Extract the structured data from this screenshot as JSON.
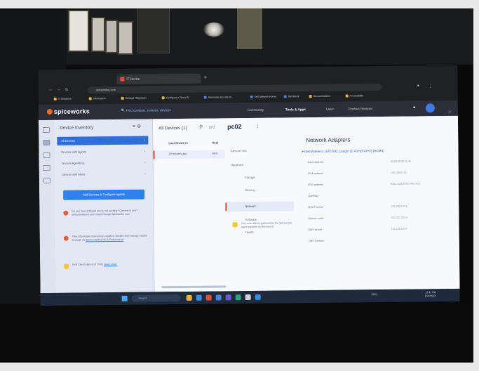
{
  "browser": {
    "tab_title": "IT Device",
    "address": "spiceworks.com",
    "bookmarks": [
      "IT Solutions",
      "Information",
      "Storage Objectives",
      "Configure a Site's Bt",
      "Associate any site to...",
      "Dell Network Home",
      "Dell Bond",
      "Documentation",
      "Accessibility"
    ]
  },
  "header": {
    "logo": "spiceworks",
    "search": "Find contents, reviews, devices",
    "nav": [
      "Community",
      "Tools & Apps",
      "Learn",
      "Product Reviews"
    ]
  },
  "sidebar": {
    "title": "Device Inventory",
    "items": [
      {
        "label": "All Devices"
      },
      {
        "label": "Devices with Agents"
      },
      {
        "label": "Devices Agentless"
      },
      {
        "label": "Devices with Alerts"
      }
    ],
    "cta": "Add Devices & Configure agents",
    "tips": [
      {
        "text": "Do you have software you're not tracking? Convert to an IT software/device and install through Spiceworks now."
      },
      {
        "text": "Take advantage of inventory analytics: Monitor and manage installs & usage on",
        "link": "Spice Dashboards & Performance"
      },
      {
        "text": "Find Cloud Apps to IT Tools",
        "link": "Learn more"
      }
    ]
  },
  "main": {
    "breadcrumb": "All Devices (1)",
    "search_value": "pc0",
    "device": "pc02",
    "columns": [
      "Last Check-in",
      "Heal"
    ],
    "rows": [
      {
        "checkin": "16 minutes ago",
        "heal": "Alert"
      }
    ],
    "nav_items": [
      {
        "label": "General Info"
      },
      {
        "label": "Hardware"
      },
      {
        "label": "Storage"
      },
      {
        "label": "Memory"
      },
      {
        "label": "Network"
      },
      {
        "label": "Software"
      },
      {
        "label": "Health"
      }
    ],
    "note": "Your scan data is gathered by the Spiceworks agent installed on this device."
  },
  "detail": {
    "title": "Network Adapters",
    "adapter": "Dell Wireless 1540 802.11a/g/n (2.4GHz/5GHz) (BCM4)",
    "fields": [
      {
        "label": "MAC address",
        "value": "E0:00:00:00:75:48"
      },
      {
        "label": "IPv4 address",
        "value": "192.168.8.113"
      },
      {
        "label": "IPv6 address",
        "value": "fe80::1a2b:8765:4dfa:4f35"
      },
      {
        "label": "Gateway",
        "value": ""
      },
      {
        "label": "DHCP server",
        "value": "192.168.8.241"
      },
      {
        "label": "Subnet mask",
        "value": "255.255.255.0"
      },
      {
        "label": "DNS server",
        "value": "192.168.8.241"
      },
      {
        "label": "DNS Domain",
        "value": ""
      }
    ]
  },
  "taskbar": {
    "search": "Search",
    "tray": "ENG",
    "time": "12:41 PM",
    "date": "1/22/2024"
  }
}
